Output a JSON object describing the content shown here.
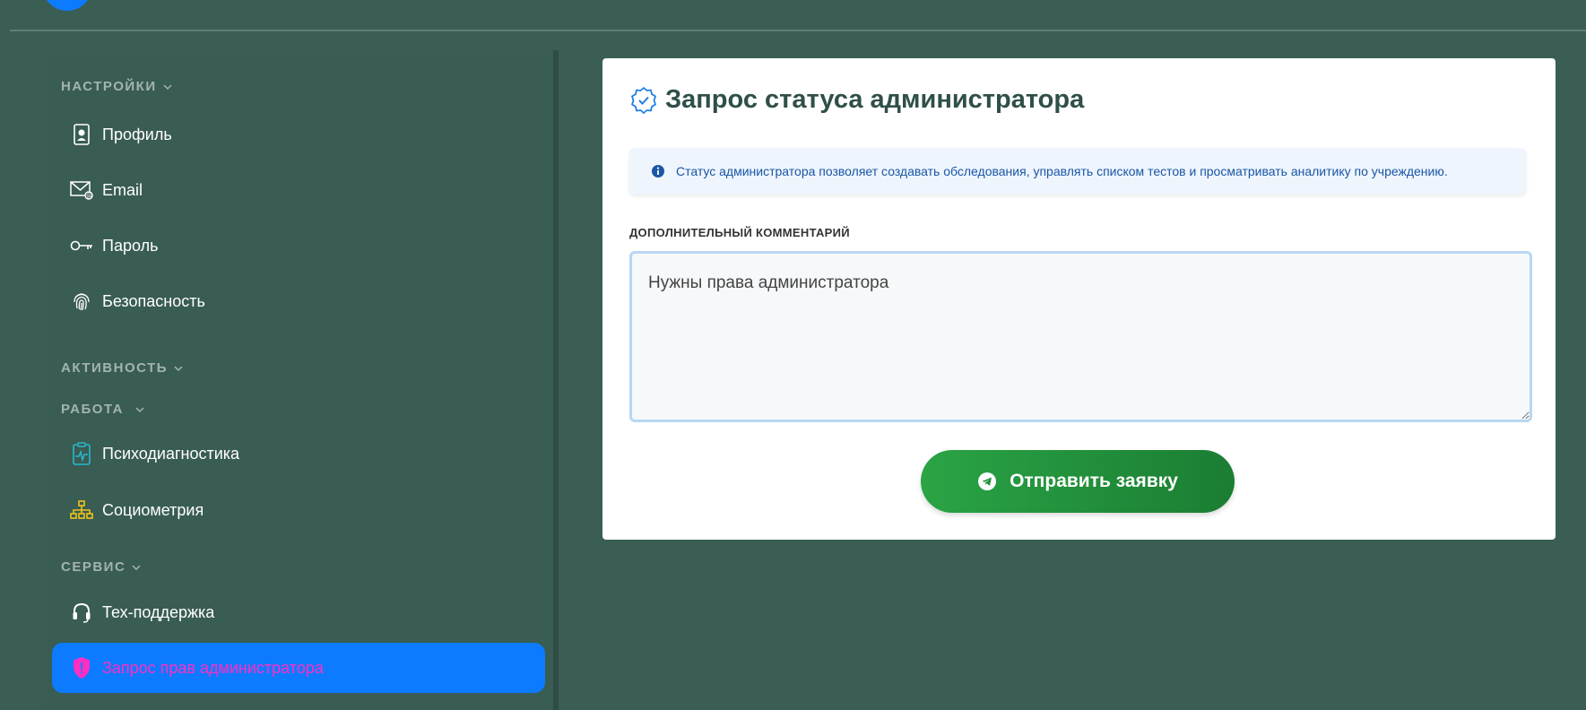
{
  "sidebar": {
    "sections": [
      {
        "title": "НАСТРОЙКИ"
      },
      {
        "title": "АКТИВНОСТЬ"
      },
      {
        "title": "РАБОТА"
      },
      {
        "title": "СЕРВИС"
      }
    ],
    "items": [
      {
        "label": "Профиль",
        "icon": "profile-card-icon"
      },
      {
        "label": "Email",
        "icon": "email-icon"
      },
      {
        "label": "Пароль",
        "icon": "key-icon"
      },
      {
        "label": "Безопасность",
        "icon": "fingerprint-icon"
      },
      {
        "label": "Психодиагностика",
        "icon": "clipboard-pulse-icon"
      },
      {
        "label": "Социометрия",
        "icon": "hierarchy-icon"
      },
      {
        "label": "Тех-поддержка",
        "icon": "headset-icon"
      },
      {
        "label": "Запрос прав администратора",
        "icon": "shield-alert-icon",
        "active": true
      }
    ]
  },
  "main": {
    "title": "Запрос статуса администратора",
    "info": "Статус администратора позволяет создавать обследования, управлять списком тестов и просматривать аналитику по учреждению.",
    "comment_label": "ДОПОЛНИТЕЛЬНЫЙ КОММЕНТАРИЙ",
    "comment_value": "Нужны права администратора",
    "submit_label": "Отправить заявку"
  },
  "colors": {
    "background": "#3a5d54",
    "active_item": "#0d7bff",
    "active_text": "#ff2ec4",
    "submit": "#2aa445"
  }
}
